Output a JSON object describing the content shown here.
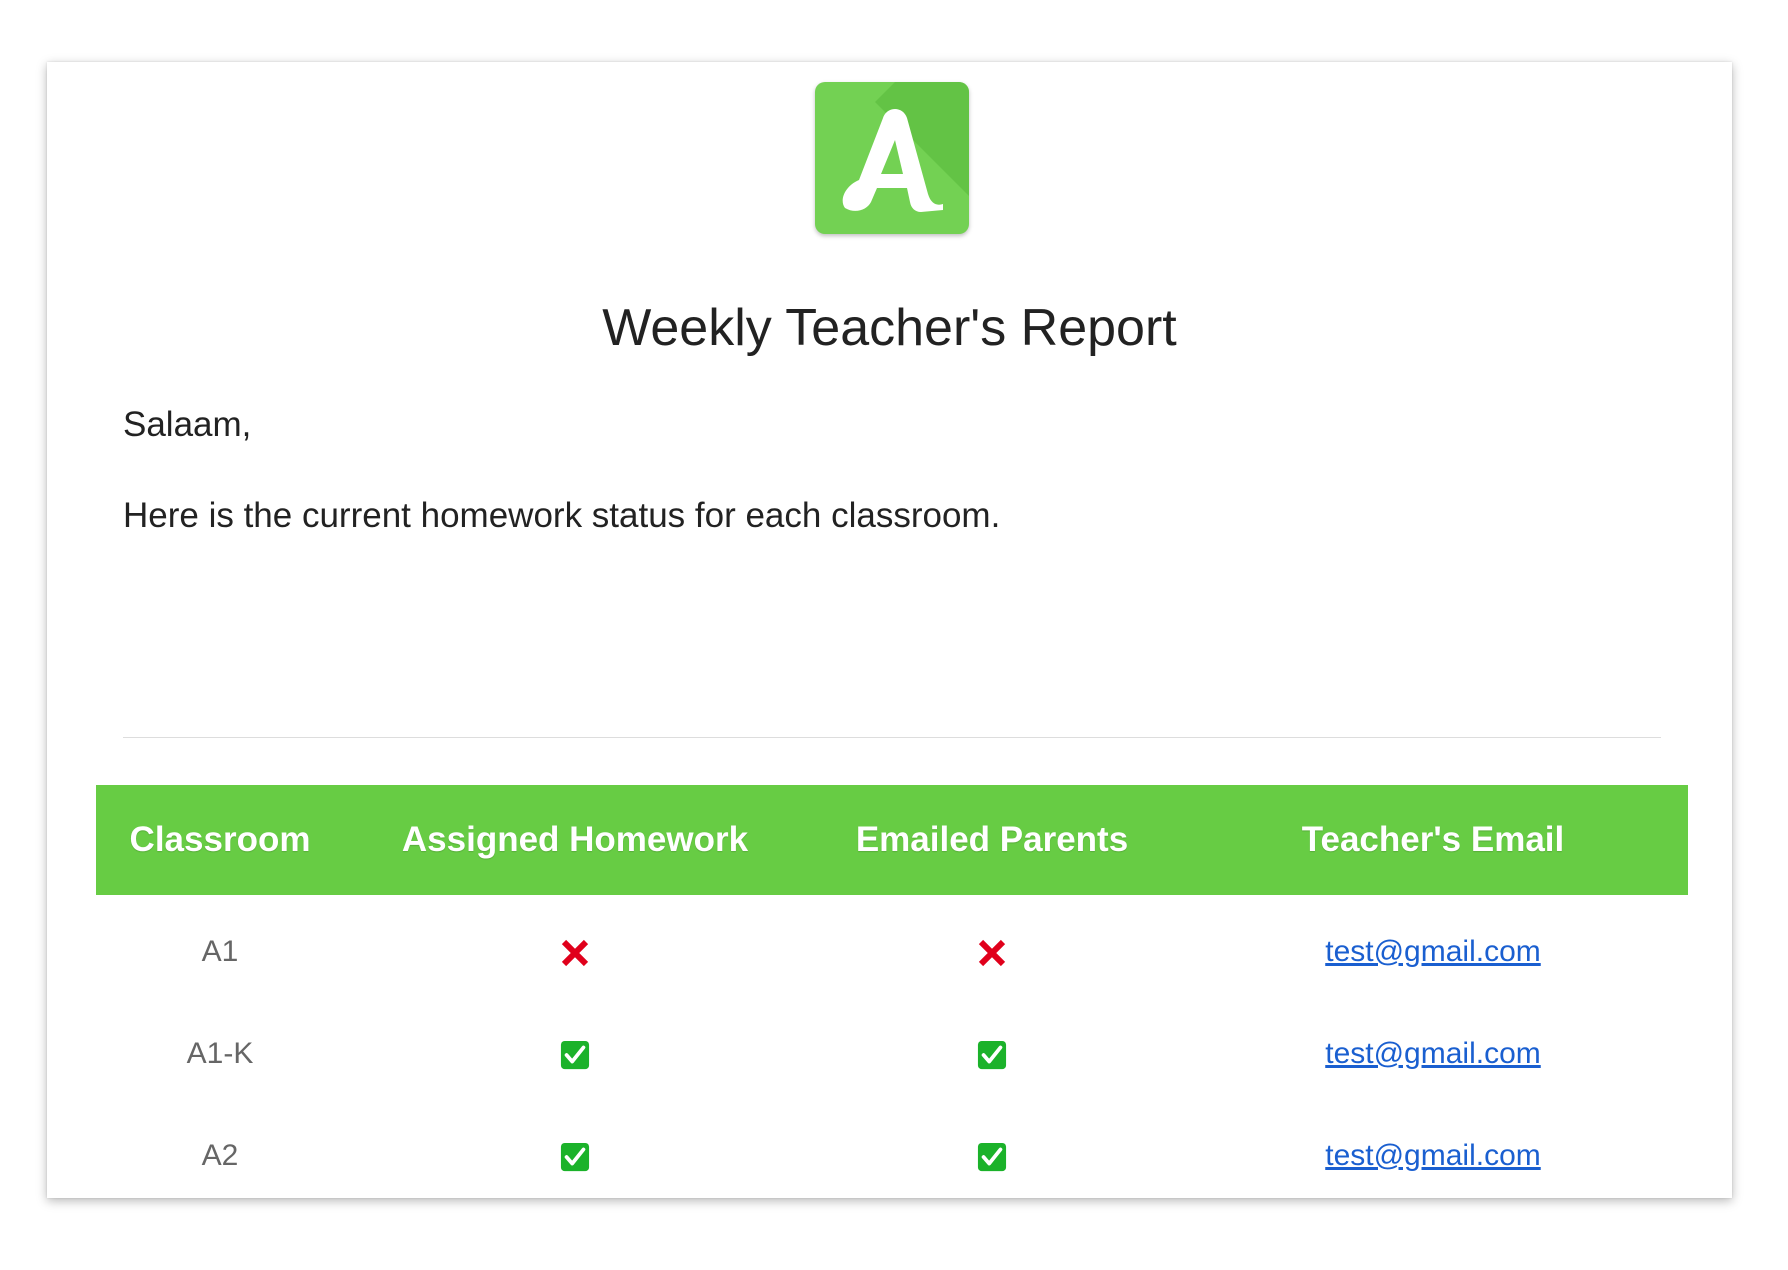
{
  "logo": {
    "letter": "A",
    "color": "#73d153"
  },
  "report": {
    "title": "Weekly Teacher's Report",
    "greeting": "Salaam,",
    "intro": "Here is the current homework status for each classroom."
  },
  "table": {
    "header_color": "#67cc44",
    "headers": [
      "Classroom",
      "Assigned Homework",
      "Emailed Parents",
      "Teacher's Email"
    ],
    "rows": [
      {
        "classroom": "A1",
        "assigned_homework": false,
        "emailed_parents": false,
        "email": "test@gmail.com"
      },
      {
        "classroom": "A1-K",
        "assigned_homework": true,
        "emailed_parents": true,
        "email": "test@gmail.com"
      },
      {
        "classroom": "A2",
        "assigned_homework": true,
        "emailed_parents": true,
        "email": "test@gmail.com"
      }
    ]
  },
  "icons": {
    "true": "check-icon",
    "false": "cross-icon"
  },
  "colors": {
    "cross": "#e0001b",
    "check": "#1bb22a",
    "link": "#1a5fd0"
  }
}
